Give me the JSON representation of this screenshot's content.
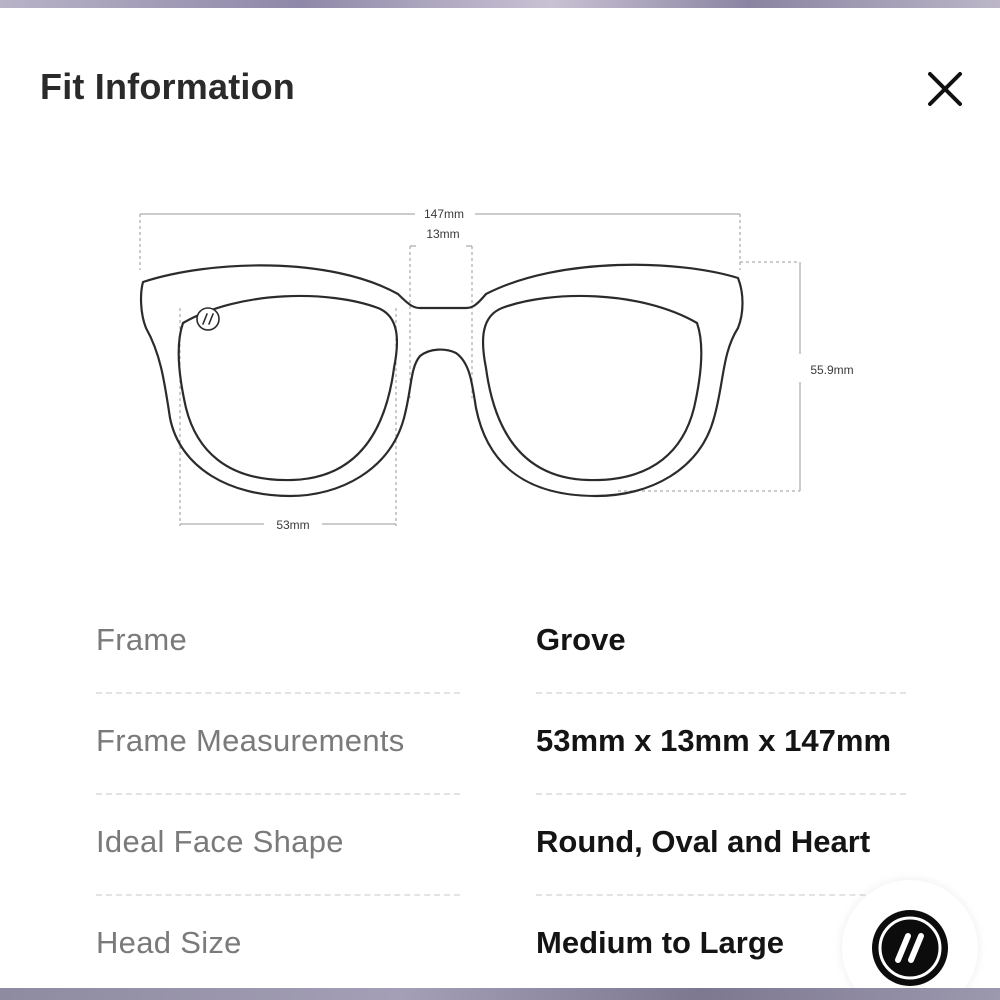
{
  "modal": {
    "title": "Fit Information",
    "close_icon": "close-icon"
  },
  "diagram": {
    "total_width": "147mm",
    "bridge_width": "13mm",
    "lens_height": "55.9mm",
    "lens_width": "53mm",
    "logo_icon": "double-slash-logo-icon"
  },
  "specs": [
    {
      "label": "Frame",
      "value": "Grove"
    },
    {
      "label": "Frame Measurements",
      "value": "53mm x 13mm x 147mm"
    },
    {
      "label": "Ideal Face Shape",
      "value": "Round, Oval and Heart"
    },
    {
      "label": "Head Size",
      "value": "Medium to Large"
    }
  ],
  "brand_button": {
    "icon": "double-slash-logo-icon"
  },
  "colors": {
    "title": "#2a2a2a",
    "label": "#7a7a7a",
    "value": "#141414",
    "outline": "#2b2b2b",
    "brand": "#0c0c0c"
  }
}
